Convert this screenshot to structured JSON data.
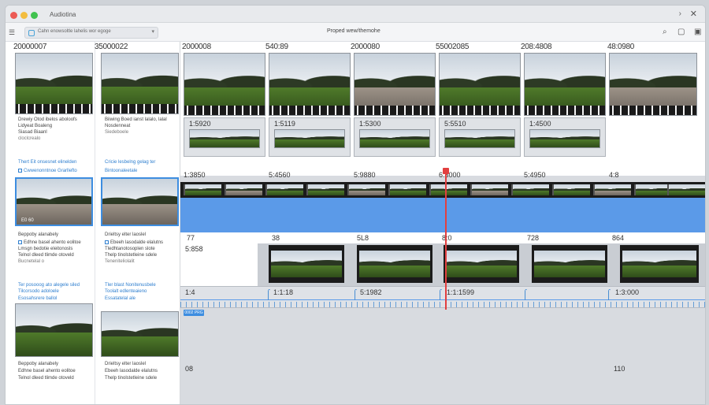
{
  "window": {
    "app_title": "Audiotina",
    "project_title": "Proped wew/themohe"
  },
  "toolbar": {
    "search_placeholder": "Cahn enowsoltle lahelis wor egoge"
  },
  "headers": {
    "left": [
      "20000007",
      "35000022"
    ],
    "timeline": [
      "2000008",
      "540:89",
      "2000080",
      "55002085",
      "208:4808",
      "48:0980"
    ]
  },
  "left_cards": [
    {
      "lines": [
        "Drewiy Otod ibelos aboloofs",
        "Lidyeat Boaleng",
        "Siasad Biaanl",
        "cloclcrealo"
      ],
      "style": "dark"
    },
    {
      "lines": [
        "Biiwing Boed ianst lalalo, lalal",
        "Nosdenneat",
        "Siedeboele"
      ],
      "style": "dark"
    },
    {
      "lines": [
        "Thert Eit onsesnet elinelden",
        "Cwwenonntnoe Grarllefto"
      ],
      "badge": "E0 60",
      "style": "road"
    },
    {
      "lines": [
        "Cricie lesbelng gelag ter",
        "Bintoonaleetale"
      ],
      "badge": "",
      "style": "road"
    },
    {
      "lines": [
        "Beppoby alanabely",
        "Edhne basel ahento eolitoe",
        "Lmsgn bedotie eleitonosls",
        "Telnol dleed tlimde otoveld",
        "Bucnetelal o"
      ],
      "style": "grass"
    },
    {
      "lines": [
        "Drieltsy elter laoslel",
        "Ebeeh lasodalde elalutns",
        "Tledhtanotosoplen slote",
        "Thelp tinolstetleine sdele",
        "Teneniteliolalit"
      ],
      "style": "grass"
    },
    {
      "lines": [
        "Ter posooog ato alegele siled",
        "Tilcorsodo adoloele",
        "Esosahsrere ballol"
      ],
      "style": "dark"
    },
    {
      "lines": [
        "Tler blast Nonitenusbele",
        "Toolalt edlenteaieno",
        "Essatatelal ale"
      ],
      "style": "grass"
    }
  ],
  "timeline": {
    "frame_labels": [
      "1:5920",
      "1:5119",
      "1:5300",
      "5:5510",
      "1:4500"
    ],
    "track_labels": [
      "1:3850",
      "5:4560",
      "5:9880",
      "6:3000",
      "5:4950",
      "4:8"
    ],
    "clip_labels": [
      "77",
      "38",
      "5L8",
      "8:0",
      "728",
      "864"
    ],
    "track2_first": "5:858",
    "ruler_labels": [
      "1:4",
      "1:1:18",
      "5:1982",
      "1:1:1599",
      "1:3:000"
    ],
    "ruler_badge": "0002 PRG",
    "bottom_labels": [
      "08",
      "110"
    ]
  }
}
